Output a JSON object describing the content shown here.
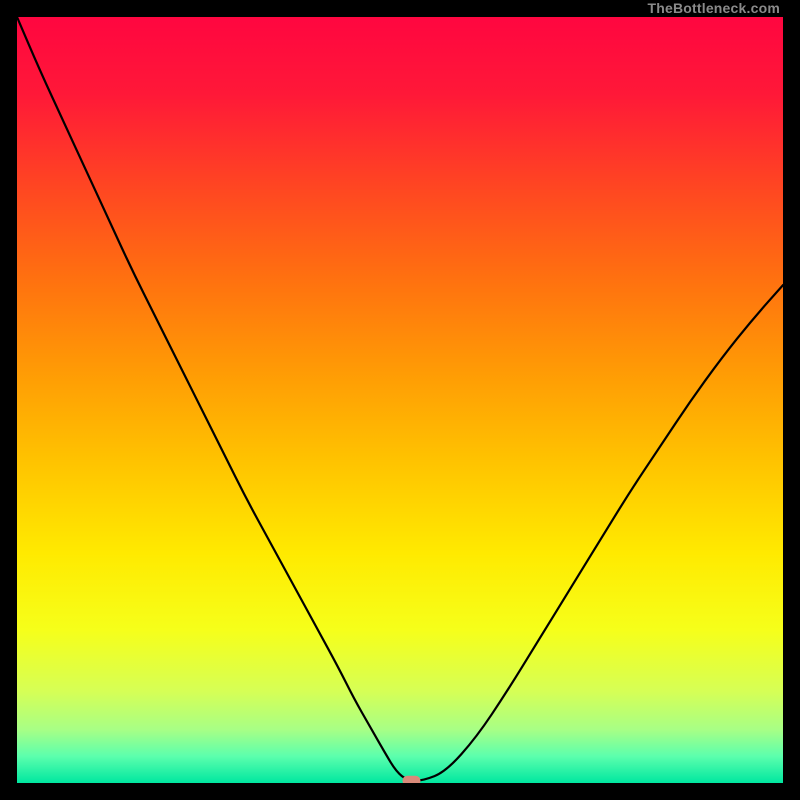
{
  "watermark": "TheBottleneck.com",
  "chart_data": {
    "type": "line",
    "title": "",
    "xlabel": "",
    "ylabel": "",
    "xlim": [
      0,
      100
    ],
    "ylim": [
      0,
      100
    ],
    "series": [
      {
        "name": "bottleneck-curve",
        "x": [
          0,
          3,
          6,
          9,
          12,
          15,
          18,
          21,
          24,
          27,
          30,
          33,
          36,
          39,
          42,
          44,
          46,
          48,
          49.5,
          51,
          53,
          56,
          60,
          64,
          68,
          72,
          76,
          80,
          84,
          88,
          92,
          96,
          100
        ],
        "y": [
          100,
          93,
          86.5,
          80,
          73.5,
          67,
          61,
          55,
          49,
          43,
          37,
          31.5,
          26,
          20.5,
          15,
          11,
          7.5,
          4,
          1.5,
          0.3,
          0.3,
          1.5,
          6,
          12,
          18.5,
          25,
          31.5,
          38,
          44,
          50,
          55.5,
          60.5,
          65
        ]
      }
    ],
    "marker": {
      "x": 51.5,
      "y": 0.3,
      "color": "#d98a7a"
    },
    "gradient_stops": [
      {
        "offset": 0.0,
        "color": "#ff0640"
      },
      {
        "offset": 0.1,
        "color": "#ff1838"
      },
      {
        "offset": 0.22,
        "color": "#ff4522"
      },
      {
        "offset": 0.34,
        "color": "#ff7010"
      },
      {
        "offset": 0.46,
        "color": "#ff9a05"
      },
      {
        "offset": 0.58,
        "color": "#ffc300"
      },
      {
        "offset": 0.7,
        "color": "#ffea00"
      },
      {
        "offset": 0.8,
        "color": "#f6ff1a"
      },
      {
        "offset": 0.88,
        "color": "#d6ff55"
      },
      {
        "offset": 0.93,
        "color": "#a8ff85"
      },
      {
        "offset": 0.965,
        "color": "#5cffad"
      },
      {
        "offset": 1.0,
        "color": "#00e7a0"
      }
    ]
  }
}
